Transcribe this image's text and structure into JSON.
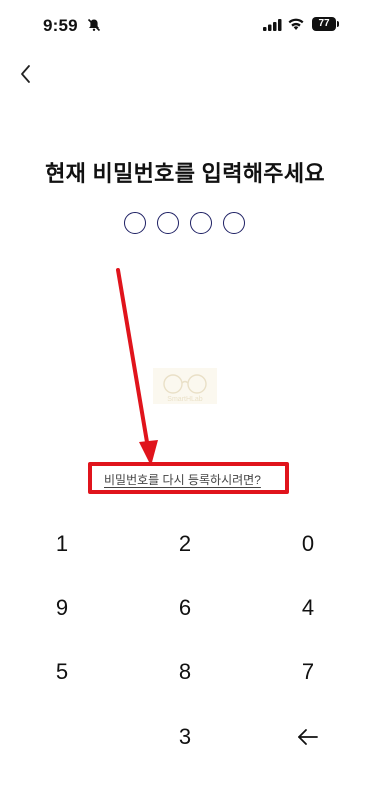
{
  "status": {
    "time": "9:59",
    "battery": "77"
  },
  "page": {
    "title": "현재 비밀번호를 입력해주세요"
  },
  "pin": {
    "length": 4,
    "filled": 0
  },
  "watermark": {
    "text": "SmartHLab"
  },
  "reset": {
    "link_label": "비밀번호를 다시 등록하시려면?"
  },
  "keypad": {
    "keys": [
      "1",
      "2",
      "0",
      "9",
      "6",
      "4",
      "5",
      "8",
      "7",
      "3"
    ]
  },
  "colors": {
    "highlight": "#e0141c",
    "pin_dot": "#1d1f63"
  }
}
